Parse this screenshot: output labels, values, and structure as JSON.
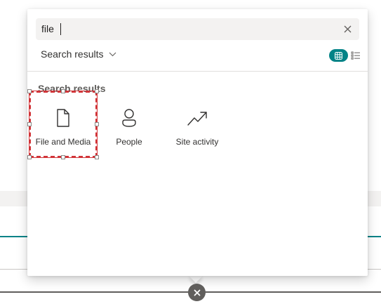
{
  "search": {
    "value": "file",
    "placeholder": ""
  },
  "scope_dropdown": {
    "label": "Search results"
  },
  "section": {
    "title": "Search results"
  },
  "categories": [
    {
      "label": "File and Media",
      "icon": "document-icon",
      "selected": true
    },
    {
      "label": "People",
      "icon": "person-icon",
      "selected": false
    },
    {
      "label": "Site activity",
      "icon": "trending-up-icon",
      "selected": false
    }
  ],
  "view_toggle": {
    "active": "grid",
    "options": [
      "grid",
      "list"
    ]
  },
  "colors": {
    "accent": "#038387",
    "selection": "#d13438",
    "panel_bg": "#ffffff",
    "search_bg": "#f3f2f1"
  }
}
